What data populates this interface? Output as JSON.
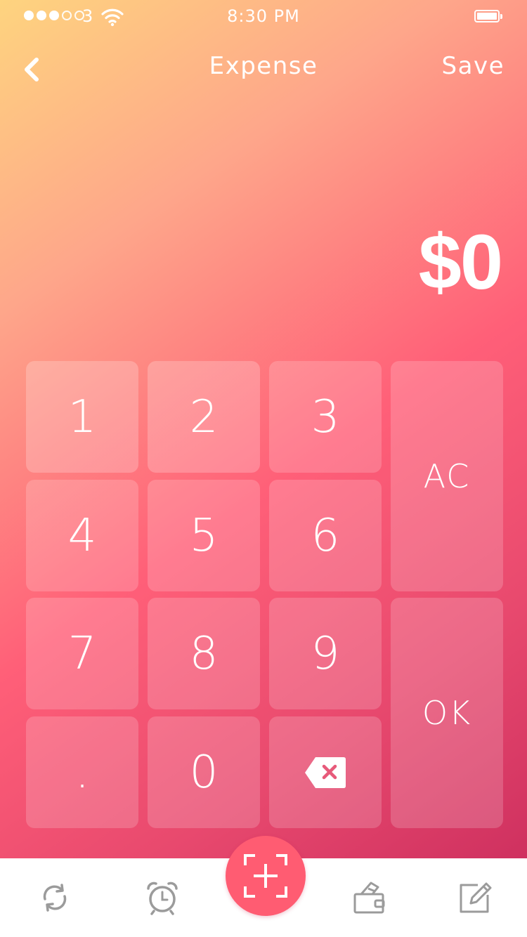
{
  "status_bar": {
    "carrier": "3",
    "time": "8:30 PM",
    "signal_dots_filled": 3,
    "signal_dots_total": 5
  },
  "nav": {
    "title": "Expense",
    "save_label": "Save",
    "back_icon": "chevron-left-icon"
  },
  "amount": {
    "display": "$0"
  },
  "keypad": {
    "keys": [
      "1",
      "2",
      "3",
      "4",
      "5",
      "6",
      "7",
      "8",
      "9",
      ".",
      "0"
    ],
    "clear_label": "AC",
    "ok_label": "OK",
    "backspace_icon": "backspace-icon"
  },
  "tabbar": {
    "icons": [
      "refresh-icon",
      "alarm-clock-icon",
      "scan-add-icon",
      "wallet-icon",
      "edit-icon"
    ],
    "accent_color": "#ff5c72",
    "icon_color": "#9b9b9b"
  },
  "colors": {
    "gradient_top": "#fed47f",
    "gradient_mid": "#ff5f78",
    "gradient_bottom": "#c7295b"
  }
}
